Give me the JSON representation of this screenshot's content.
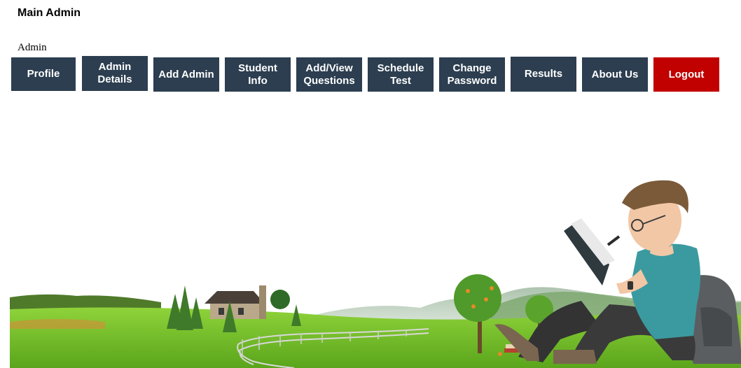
{
  "header": {
    "title": "Main Admin",
    "role": "Admin"
  },
  "nav": {
    "profile": "Profile",
    "admin_details": "Admin Details",
    "add_admin": "Add Admin",
    "student_info": "Student Info",
    "add_view_questions": "Add/View Questions",
    "schedule_test": "Schedule Test",
    "change_password": "Change Password",
    "results": "Results",
    "about_us": "About Us",
    "logout": "Logout"
  },
  "colors": {
    "nav_button": "#2c3e50",
    "logout_button": "#c10000",
    "grass": "#7cc12a",
    "shirt": "#3b9aa0"
  },
  "illustration": {
    "subject": "student-reading-illustration",
    "background": "countryside-landscape"
  }
}
